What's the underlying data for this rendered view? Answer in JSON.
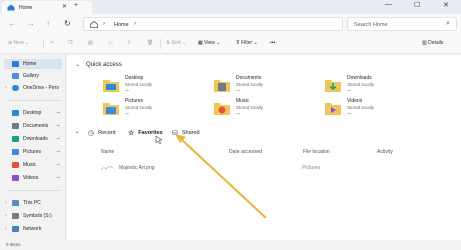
{
  "tab": {
    "title": "Home"
  },
  "window": {
    "minimize": "—",
    "maximize": "☐",
    "close": "✕",
    "close_tab": "✕",
    "new_tab": "+"
  },
  "nav": {
    "back": "←",
    "forward": "→",
    "up": "↑",
    "refresh": "↻"
  },
  "address": {
    "breadcrumb": "Home",
    "sep": "›"
  },
  "search": {
    "placeholder": "Search Home"
  },
  "toolbar": {
    "new": "New",
    "new_chev": "⌄",
    "sort": "Sort",
    "view": "View",
    "filter": "Filter",
    "more": "•••",
    "details": "Details"
  },
  "sidebar": {
    "items": [
      {
        "label": "Home",
        "color": "#2e7ad6"
      },
      {
        "label": "Gallery",
        "color": "#4a90e2"
      },
      {
        "label": "OneDrive - Pers",
        "color": "#2b88d8"
      },
      {
        "label": "Desktop",
        "color": "#2b88d8"
      },
      {
        "label": "Documents",
        "color": "#6c7a89"
      },
      {
        "label": "Downloads",
        "color": "#1aa37a"
      },
      {
        "label": "Pictures",
        "color": "#3a8fd8"
      },
      {
        "label": "Music",
        "color": "#e0533a"
      },
      {
        "label": "Videos",
        "color": "#8b4fd1"
      },
      {
        "label": "This PC",
        "color": "#5a8ac6"
      },
      {
        "label": "Symbols (S:)",
        "color": "#7a7a7a"
      },
      {
        "label": "Network",
        "color": "#4a7fc1"
      }
    ],
    "pin": "📌",
    "chev": "›"
  },
  "quick_access": {
    "title": "Quick access",
    "items": [
      {
        "name": "Desktop",
        "sub": "Stored locally",
        "color": "#2b88d8"
      },
      {
        "name": "Documents",
        "sub": "Stored locally",
        "color": "#6c7a89"
      },
      {
        "name": "Downloads",
        "sub": "Stored locally",
        "color": "#1aa37a"
      },
      {
        "name": "Pictures",
        "sub": "Stored locally",
        "color": "#3a8fd8"
      },
      {
        "name": "Music",
        "sub": "Stored locally",
        "color": "#e0533a"
      },
      {
        "name": "Videos",
        "sub": "Stored locally",
        "color": "#8b4fd1"
      }
    ]
  },
  "filetabs": {
    "recent": "Recent",
    "favorites": "Favorites",
    "shared": "Shared"
  },
  "columns": {
    "name": "Name",
    "date": "Date accessed",
    "location": "File location",
    "activity": "Activity"
  },
  "files": [
    {
      "name": "Majestic Art.png",
      "location": "Pictures"
    }
  ],
  "status": {
    "count": "0 items"
  },
  "colors": {
    "accent": "#2e7ad6",
    "annotation_arrow": "#e9b43a"
  }
}
